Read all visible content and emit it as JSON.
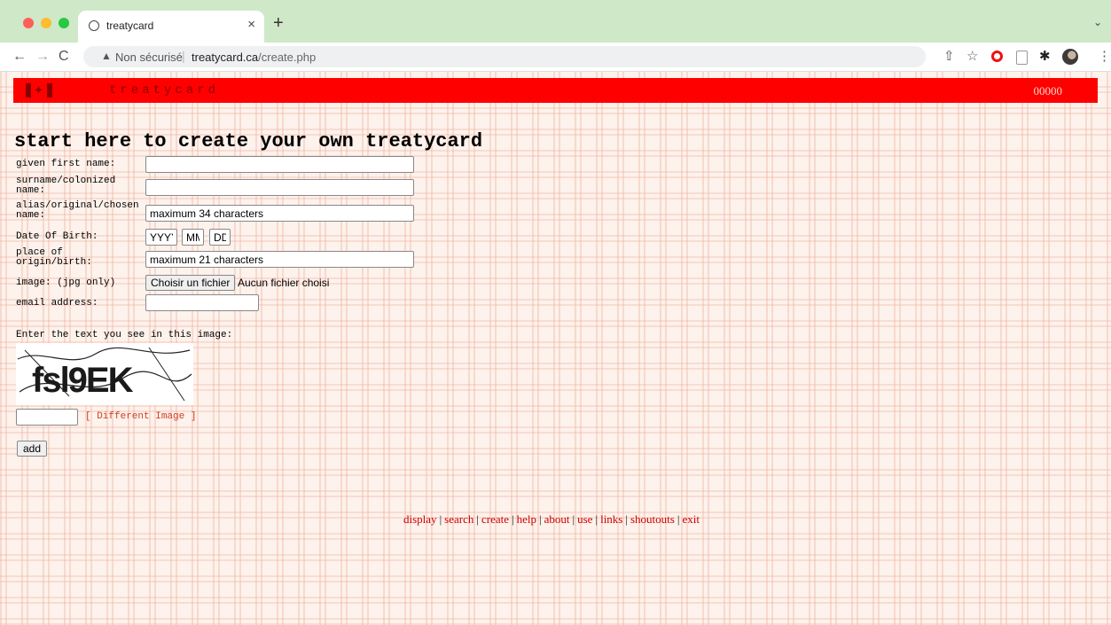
{
  "browser": {
    "tab_title": "treatycard",
    "tab_close": "×",
    "new_tab": "+",
    "tabs_menu": "⌄",
    "security_warning": "Non sécurisé",
    "url_host": "treatycard.ca",
    "url_path": "/create.php"
  },
  "header": {
    "brand": "treatycard",
    "counter": "00000",
    "colors": {
      "banner": "#ff0000",
      "brand_text": "#8a0000"
    }
  },
  "form": {
    "title": "start here to create your own treatycard",
    "fields": {
      "given_first_name": {
        "label": "given first name:",
        "value": ""
      },
      "surname": {
        "label": "surname/colonized name:",
        "value": ""
      },
      "alias": {
        "label": "alias/original/chosen name:",
        "value": "maximum 34 characters"
      },
      "dob": {
        "label": "Date Of Birth:",
        "year_placeholder": "YYYY",
        "month_placeholder": "MM",
        "day_placeholder": "DD"
      },
      "place": {
        "label": "place of origin/birth:",
        "value": "maximum 21 characters"
      },
      "image": {
        "label": "image: (jpg only)",
        "button": "Choisir un fichier",
        "status": "Aucun fichier choisi"
      },
      "email": {
        "label": "email address:",
        "value": ""
      }
    },
    "captcha": {
      "prompt": "Enter the text you see in this image:",
      "image_text": "fsl9EK",
      "input_value": "",
      "different_image": "[ Different Image ]"
    },
    "submit_label": "add"
  },
  "footer": {
    "links": [
      "display",
      "search",
      "create",
      "help",
      "about",
      "use",
      "links",
      "shoutouts",
      "exit"
    ]
  }
}
